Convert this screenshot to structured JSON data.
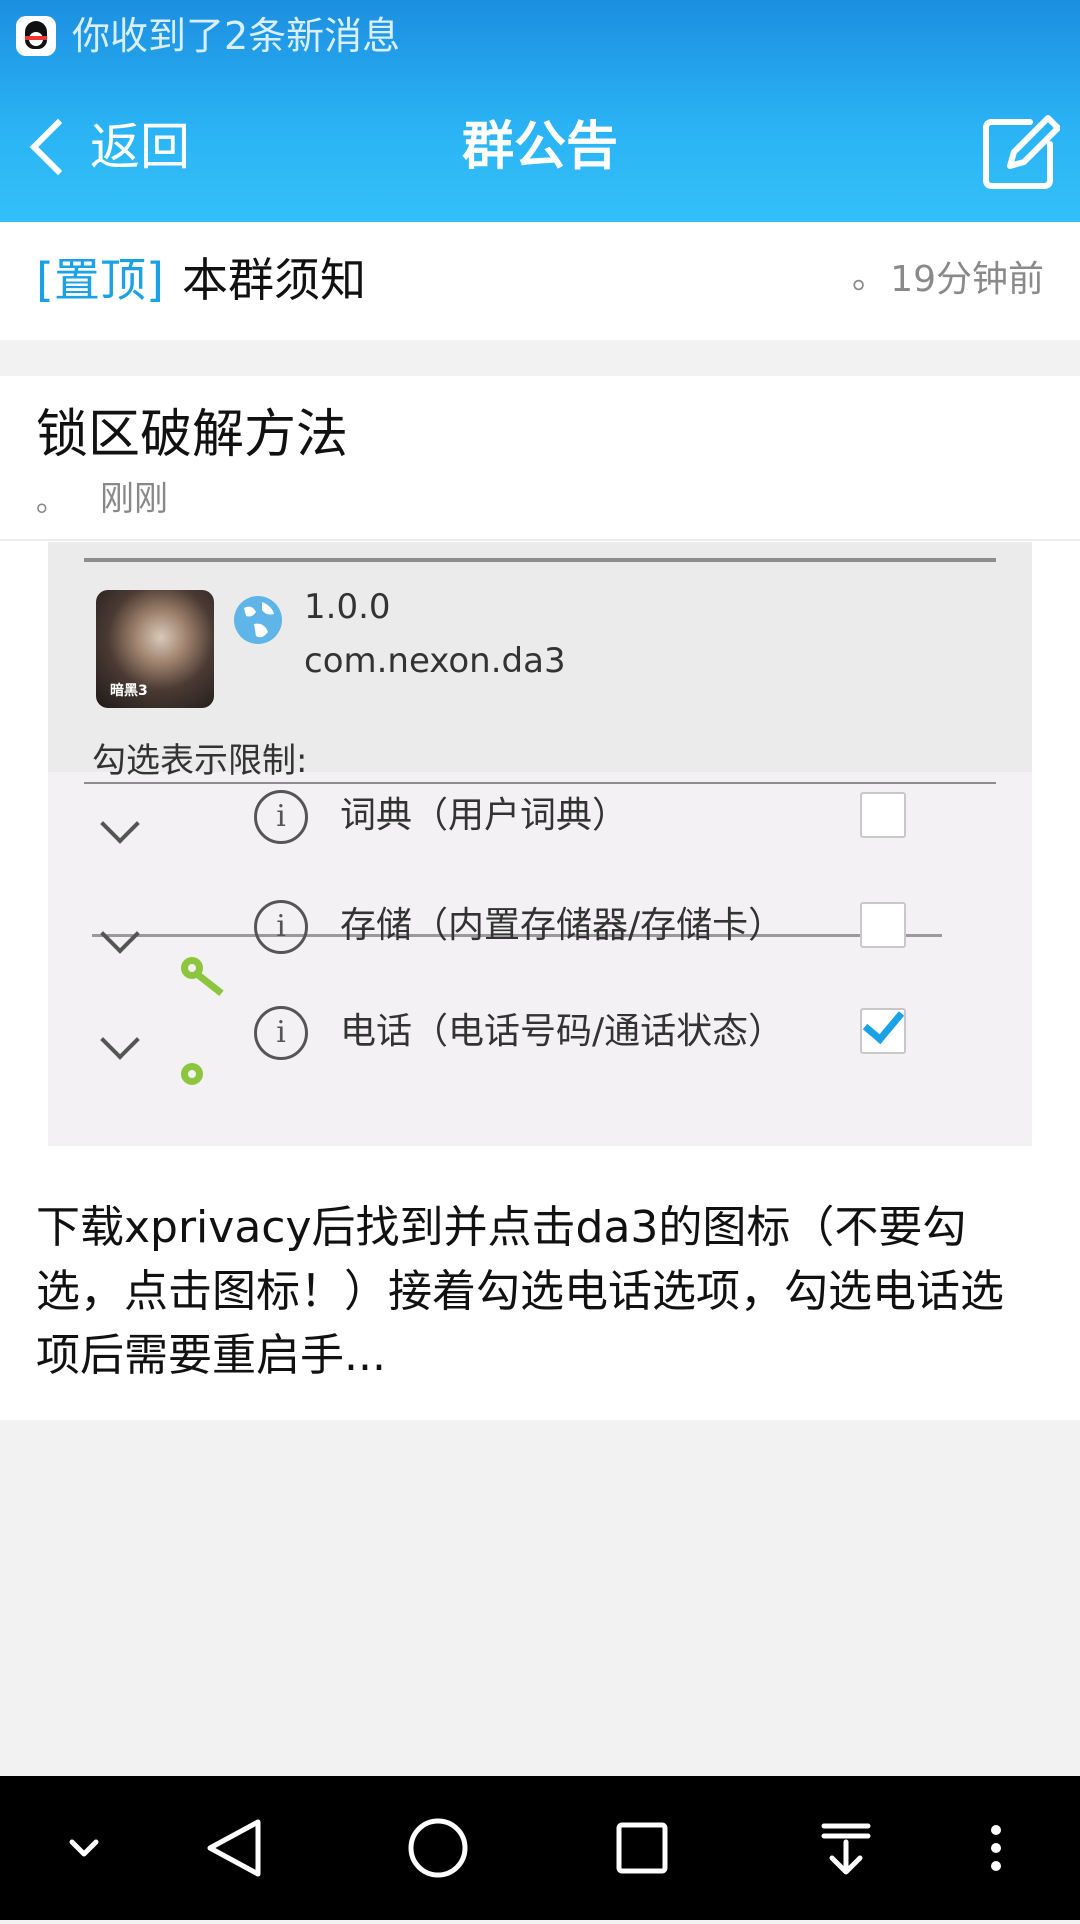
{
  "status_bar": {
    "app_icon": "qq-penguin-icon",
    "notification_text": "你收到了2条新消息"
  },
  "navbar": {
    "back_label": "返回",
    "title": "群公告",
    "edit_icon": "edit-icon"
  },
  "pinned": {
    "tag": "[置顶]",
    "title": "本群须知",
    "dot": "。",
    "time": "19分钟前"
  },
  "announcement": {
    "title": "锁区破解方法",
    "dot": "。",
    "time": "刚刚",
    "screenshot": {
      "version": "1.0.0",
      "package": "com.nexon.da3",
      "label": "勾选表示限制:",
      "permissions": [
        {
          "text": "词典（用户词典）",
          "checked": false
        },
        {
          "text": "存储（内置存储器/存储卡）",
          "checked": false
        },
        {
          "text": "电话（电话号码/通话状态）",
          "checked": true
        }
      ]
    },
    "body": "下载xprivacy后找到并点击da3的图标（不要勾选，点击图标！）接着勾选电话选项，勾选电话选项后需要重启手..."
  },
  "bottom_nav": [
    "chevron-down-icon",
    "back-triangle-icon",
    "home-circle-icon",
    "recents-square-icon",
    "pull-down-icon",
    "more-vertical-icon"
  ],
  "colors": {
    "header_start": "#1c8fe0",
    "header_end": "#33c0f8",
    "accent": "#1aa1e6",
    "page_background": "#f2f2f2"
  }
}
